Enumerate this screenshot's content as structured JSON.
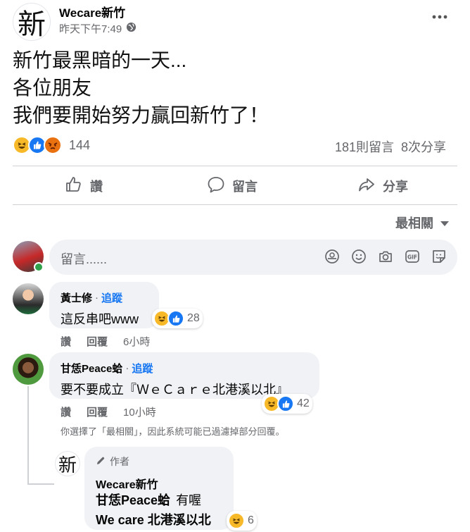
{
  "post": {
    "page_name": "Wecare新竹",
    "page_avatar_glyph": "新",
    "time": "昨天下午7:49",
    "text_lines": [
      "新竹最黑暗的一天...",
      "各位朋友",
      "我們要開始努力贏回新竹了！"
    ],
    "reaction_count": "144",
    "comments_count": "181則留言",
    "shares_count": "8次分享"
  },
  "actions": {
    "like": "讚",
    "comment": "留言",
    "share": "分享"
  },
  "sort_label": "最相關",
  "composer": {
    "placeholder": "留言......"
  },
  "comments": [
    {
      "name": "黃士修",
      "follow": "追蹤",
      "text": "這反串吧www",
      "reaction_count": "28",
      "like": "讚",
      "reply": "回覆",
      "time": "6小時"
    },
    {
      "name": "甘恁Peace蛤",
      "follow": "追蹤",
      "text": "要不要成立『ＷｅＣａｒｅ北港溪以北』",
      "reaction_count": "42",
      "like": "讚",
      "reply": "回覆",
      "time": "10小時"
    }
  ],
  "filter_note": "你選擇了「最相關」，因此系統可能已過濾掉部分回覆。",
  "reply": {
    "avatar_glyph": "新",
    "author_badge": "作者",
    "name": "Wecare新竹",
    "line1": "甘恁Peace蛤",
    "line1_suffix": "有喔",
    "line2": "We care 北港溪以北",
    "reaction_count": "6"
  },
  "colors": {
    "accent": "#1877f2",
    "muted": "#65676b",
    "bubble": "#f0f2f5",
    "online": "#31a24c"
  }
}
